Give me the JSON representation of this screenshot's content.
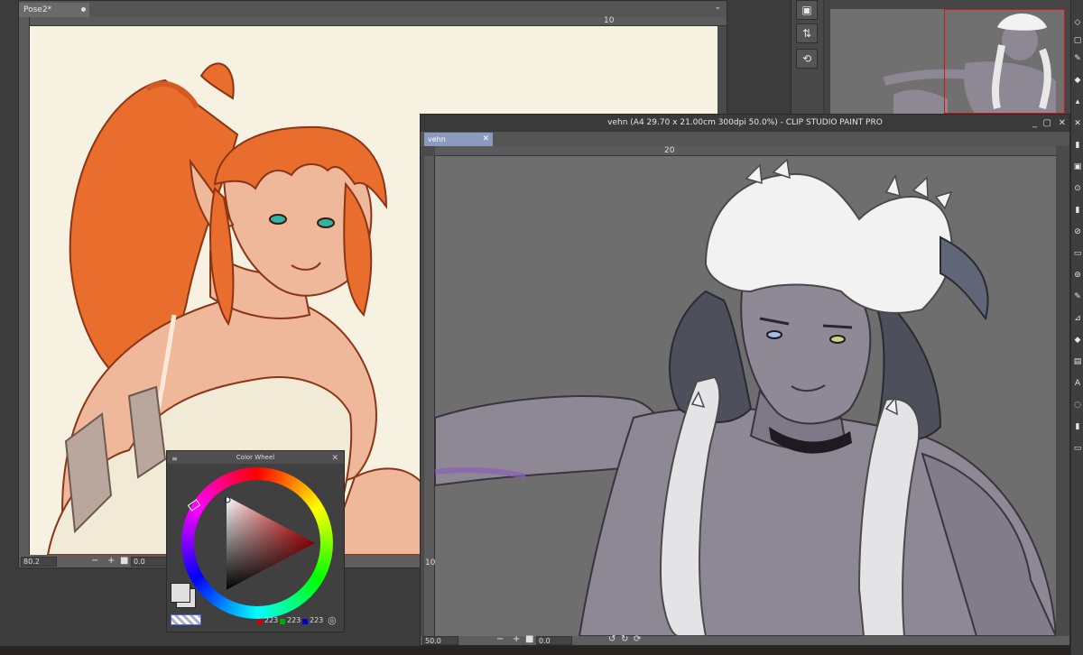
{
  "left_window": {
    "tab_title": "Pose2*",
    "ruler_label": "10",
    "status": {
      "zoom": "80.2",
      "rotation": "0.0",
      "zoom_out": "−",
      "zoom_in": "+"
    }
  },
  "color_wheel": {
    "title": "Color Wheel",
    "rgb": {
      "r": "223",
      "g": "223",
      "b": "223"
    }
  },
  "main_window": {
    "title": "vehn (A4 29.70 x 21.00cm 300dpi 50.0%) - CLIP STUDIO PAINT PRO",
    "tab_title": "vehn",
    "ruler_top_label": "20",
    "ruler_side_label": "10",
    "status": {
      "zoom": "50.0",
      "rotation": "0.0",
      "zoom_out": "−",
      "zoom_in": "+"
    }
  },
  "colors": {
    "canvas_cream": "#f7f1e1",
    "canvas_gray": "#6e6e6e",
    "active_tab": "#8c9ac0",
    "navigator_frame": "#e01010",
    "hair_orange": "#e96d2d",
    "skin_peach": "#f0b89a",
    "skin_gray": "#8e8794",
    "hair_white": "#f2f2f2"
  },
  "icons": {
    "side_strip": [
      "animation-icon",
      "adjust-icon",
      "repeat-icon"
    ],
    "window_buttons": [
      "minimize-icon",
      "maximize-icon",
      "close-icon"
    ]
  }
}
